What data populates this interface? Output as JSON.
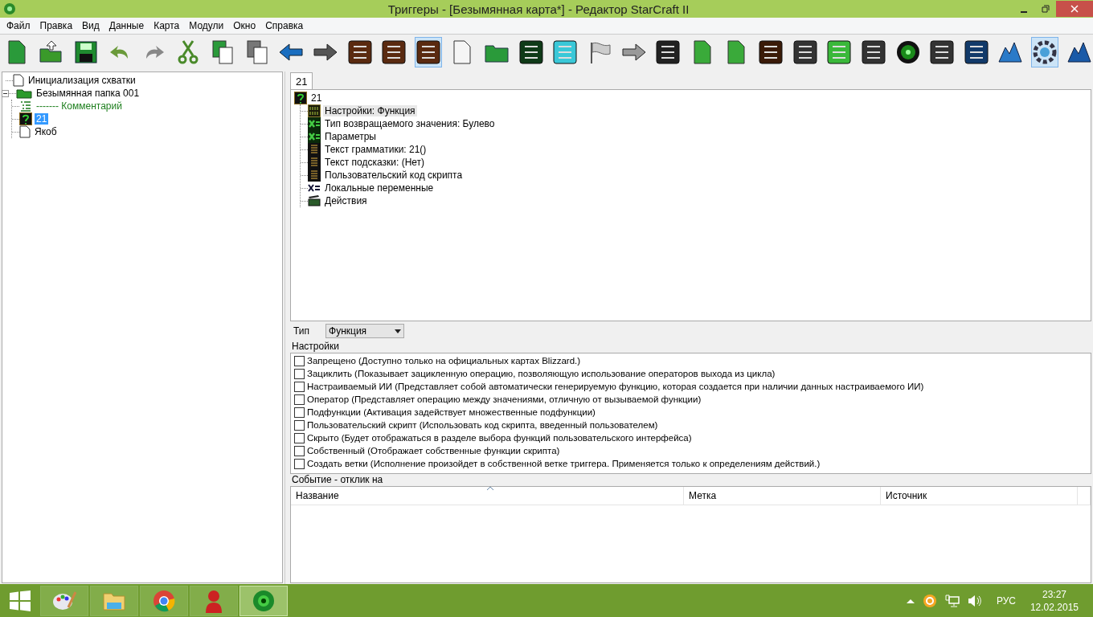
{
  "window": {
    "title": "Триггеры - [Безымянная карта*] - Редактор StarCraft II"
  },
  "menu": [
    "Файл",
    "Правка",
    "Вид",
    "Данные",
    "Карта",
    "Модули",
    "Окно",
    "Справка"
  ],
  "toolbar": [
    {
      "kind": "new",
      "selected": false
    },
    {
      "kind": "open",
      "selected": false
    },
    {
      "kind": "save",
      "selected": false
    },
    {
      "kind": "undo",
      "selected": false
    },
    {
      "kind": "redo",
      "selected": false
    },
    {
      "kind": "cut",
      "selected": false
    },
    {
      "kind": "copy",
      "selected": false
    },
    {
      "kind": "paste",
      "selected": false
    },
    {
      "kind": "back",
      "selected": false
    },
    {
      "kind": "forward",
      "selected": false
    },
    {
      "kind": "brown",
      "selected": false
    },
    {
      "kind": "brown",
      "selected": false
    },
    {
      "kind": "brown",
      "selected": true
    },
    {
      "kind": "page",
      "selected": false
    },
    {
      "kind": "folder",
      "selected": false
    },
    {
      "kind": "darkgreen",
      "selected": false
    },
    {
      "kind": "cyan",
      "selected": false
    },
    {
      "kind": "flag",
      "selected": false
    },
    {
      "kind": "arrows",
      "selected": false
    },
    {
      "kind": "clapper",
      "selected": false
    },
    {
      "kind": "greenpage",
      "selected": false
    },
    {
      "kind": "greenpage",
      "selected": false
    },
    {
      "kind": "orange",
      "selected": false
    },
    {
      "kind": "gray",
      "selected": false
    },
    {
      "kind": "green",
      "selected": false
    },
    {
      "kind": "gray",
      "selected": false
    },
    {
      "kind": "disc",
      "selected": false
    },
    {
      "kind": "gray",
      "selected": false
    },
    {
      "kind": "blue",
      "selected": false
    },
    {
      "kind": "mountain",
      "selected": false
    },
    {
      "kind": "gear",
      "selected": true
    },
    {
      "kind": "unit",
      "selected": false
    }
  ],
  "left_tree": [
    {
      "label": "Инициализация схватки",
      "kind": "trigger",
      "selected": false
    },
    {
      "label": "Безымянная папка 001",
      "kind": "folder",
      "selected": false,
      "expanded": true,
      "children": [
        {
          "label": "------- Комментарий",
          "kind": "comment",
          "selected": false
        },
        {
          "label": "21",
          "kind": "function",
          "selected": true
        },
        {
          "label": "Якоб",
          "kind": "trigger",
          "selected": false
        }
      ]
    }
  ],
  "tab": {
    "label": "21",
    "selected": true
  },
  "detail_tree": {
    "label": "21",
    "kind": "function",
    "children": [
      {
        "label": "Настройки: Функция",
        "kind": "binary",
        "selected": true
      },
      {
        "label": "Тип возвращаемого значения: Булево",
        "kind": "variable",
        "selected": false
      },
      {
        "label": "Параметры",
        "kind": "variable",
        "selected": false
      },
      {
        "label": "Текст грамматики: 21()",
        "kind": "text",
        "selected": false
      },
      {
        "label": "Текст подсказки: (Нет)",
        "kind": "text",
        "selected": false
      },
      {
        "label": "Пользовательский код скрипта",
        "kind": "text",
        "selected": false
      },
      {
        "label": "Локальные переменные",
        "kind": "locals",
        "selected": false
      },
      {
        "label": "Действия",
        "kind": "actions",
        "selected": false
      }
    ]
  },
  "type_field": {
    "label": "Тип",
    "value": "Функция"
  },
  "settings": {
    "label": "Настройки",
    "options": [
      {
        "label": "Запрещено (Доступно только на официальных картах Blizzard.)",
        "checked": false
      },
      {
        "label": "Зациклить (Показывает зацикленную операцию, позволяющую использование операторов выхода из цикла)",
        "checked": false
      },
      {
        "label": "Настраиваемый ИИ (Представляет собой автоматически генерируемую функцию, которая создается при наличии данных настраиваемого ИИ)",
        "checked": false
      },
      {
        "label": "Оператор (Представляет операцию между значениями, отличную от вызываемой функции)",
        "checked": false
      },
      {
        "label": "Подфункции (Активация задействует множественные подфункции)",
        "checked": false
      },
      {
        "label": "Пользовательский скрипт (Использовать код скрипта, введенный пользователем)",
        "checked": false
      },
      {
        "label": "Скрыто (Будет отображаться в разделе выбора функций пользовательского интерфейса)",
        "checked": false
      },
      {
        "label": "Собственный (Отображает собственные функции скрипта)",
        "checked": false
      },
      {
        "label": "Создать ветки (Исполнение произойдет в собственной ветке триггера. Применяется только к определениям действий.)",
        "checked": false
      }
    ]
  },
  "events": {
    "label": "Событие - отклик на",
    "columns": [
      {
        "label": "Название",
        "sorted": true
      },
      {
        "label": "Метка",
        "sorted": false
      },
      {
        "label": "Источник",
        "sorted": false
      }
    ]
  },
  "taskbar": {
    "apps": [
      {
        "kind": "paint",
        "selected": false
      },
      {
        "kind": "explorer",
        "selected": false
      },
      {
        "kind": "chrome",
        "selected": false
      },
      {
        "kind": "agent",
        "selected": false
      },
      {
        "kind": "editor",
        "selected": true
      }
    ],
    "language": "РУС",
    "time": "23:27",
    "date": "12.02.2015"
  }
}
